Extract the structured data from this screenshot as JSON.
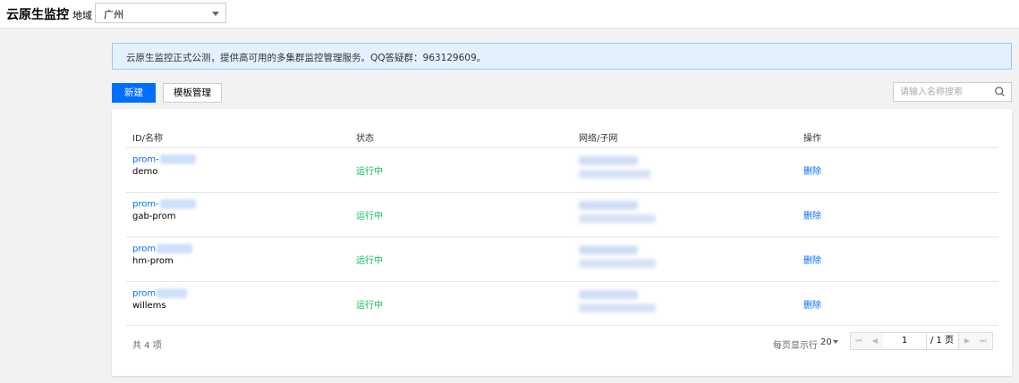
{
  "header": {
    "title": "云原生监控",
    "region_label": "地域",
    "region_value": "广州"
  },
  "notice": {
    "text": "云原生监控正式公测，提供高可用的多集群监控管理服务。QQ答疑群：963129609。"
  },
  "toolbar": {
    "new_label": "新建",
    "template_label": "模板管理",
    "search_placeholder": "请输入名称搜索"
  },
  "table": {
    "columns": [
      "ID/名称",
      "状态",
      "网络/子网",
      "操作"
    ],
    "rows": [
      {
        "id_prefix": "prom-",
        "name": "demo",
        "status": "运行中",
        "action": "删除"
      },
      {
        "id_prefix": "prom-",
        "name": "gab-prom",
        "status": "运行中",
        "action": "删除"
      },
      {
        "id_prefix": "prom",
        "name": "hm-prom",
        "status": "运行中",
        "action": "删除"
      },
      {
        "id_prefix": "prom",
        "name": "willems",
        "status": "运行中",
        "action": "删除"
      }
    ]
  },
  "footer": {
    "total": "共 4 项",
    "page_size_label": "每页显示行",
    "page_size": "20",
    "current_page": "1",
    "total_pages": "/ 1 页"
  },
  "colors": {
    "accent": "#006eff",
    "running": "#0abf5b",
    "notice_bg": "#e5f0ff",
    "page_bg": "#f2f2f2"
  }
}
